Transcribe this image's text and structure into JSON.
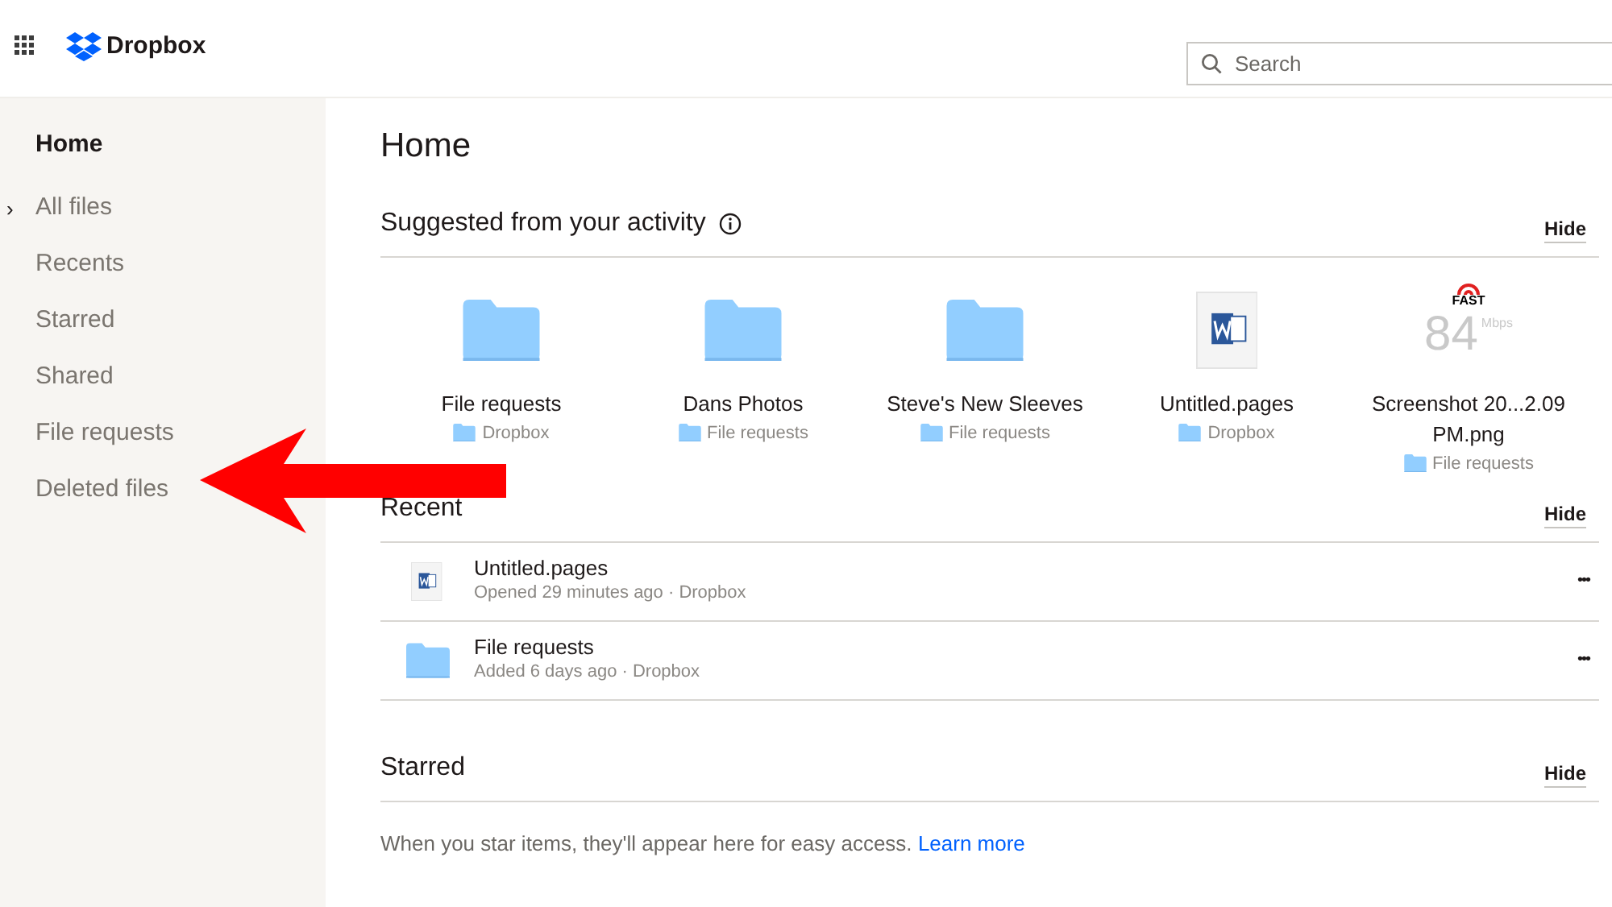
{
  "header": {
    "brand": "Dropbox",
    "search": {
      "placeholder": "Search"
    }
  },
  "sidebar": {
    "items": [
      {
        "label": "Home",
        "selected": true
      },
      {
        "label": "All files",
        "selected": false,
        "chevron": "›"
      },
      {
        "label": "Recents",
        "selected": false
      },
      {
        "label": "Starred",
        "selected": false
      },
      {
        "label": "Shared",
        "selected": false
      },
      {
        "label": "File requests",
        "selected": false
      },
      {
        "label": "Deleted files",
        "selected": false
      }
    ]
  },
  "page_title": "Home",
  "suggested": {
    "title": "Suggested from your activity",
    "hide": "Hide",
    "items": [
      {
        "kind": "folder",
        "name": "File requests",
        "location": "Dropbox"
      },
      {
        "kind": "folder",
        "name": "Dans Photos",
        "location": "File requests"
      },
      {
        "kind": "folder",
        "name": "Steve's New Sleeves",
        "location": "File requests"
      },
      {
        "kind": "doc",
        "name": "Untitled.pages",
        "location": "Dropbox"
      },
      {
        "kind": "image",
        "name": "Screenshot 20...2.09 PM.png",
        "location": "File requests",
        "thumb": {
          "logo": "FAST",
          "speed": "84",
          "unit": "Mbps"
        }
      }
    ]
  },
  "recent": {
    "title": "Recent",
    "hide": "Hide",
    "items": [
      {
        "kind": "doc",
        "name": "Untitled.pages",
        "detail": "Opened 29 minutes ago · Dropbox",
        "more": "•••"
      },
      {
        "kind": "folder",
        "name": "File requests",
        "detail": "Added 6 days ago · Dropbox",
        "more": "•••"
      }
    ]
  },
  "starred": {
    "title": "Starred",
    "hide": "Hide",
    "message": "When you star items, they'll appear here for easy access.",
    "link": "Learn more"
  }
}
